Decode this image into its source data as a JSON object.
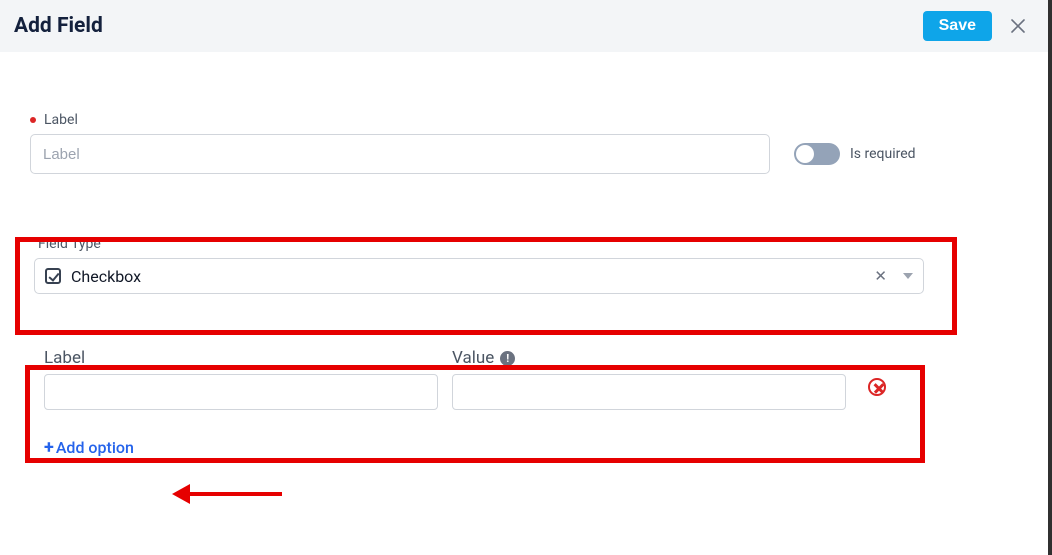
{
  "header": {
    "title": "Add Field",
    "save_label": "Save"
  },
  "label_field": {
    "heading": "Label",
    "placeholder": "Label",
    "value": ""
  },
  "required_toggle": {
    "label": "Is required",
    "state": "off"
  },
  "field_type": {
    "heading": "Field Type",
    "selected": "Checkbox",
    "icon": "checkbox-icon"
  },
  "option_row": {
    "label_heading": "Label",
    "value_heading": "Value",
    "label_value": "",
    "value_value": ""
  },
  "add_option_label": "Add option",
  "colors": {
    "primary": "#0ea5e9",
    "danger": "#dc2626",
    "annotation": "#e60000"
  }
}
